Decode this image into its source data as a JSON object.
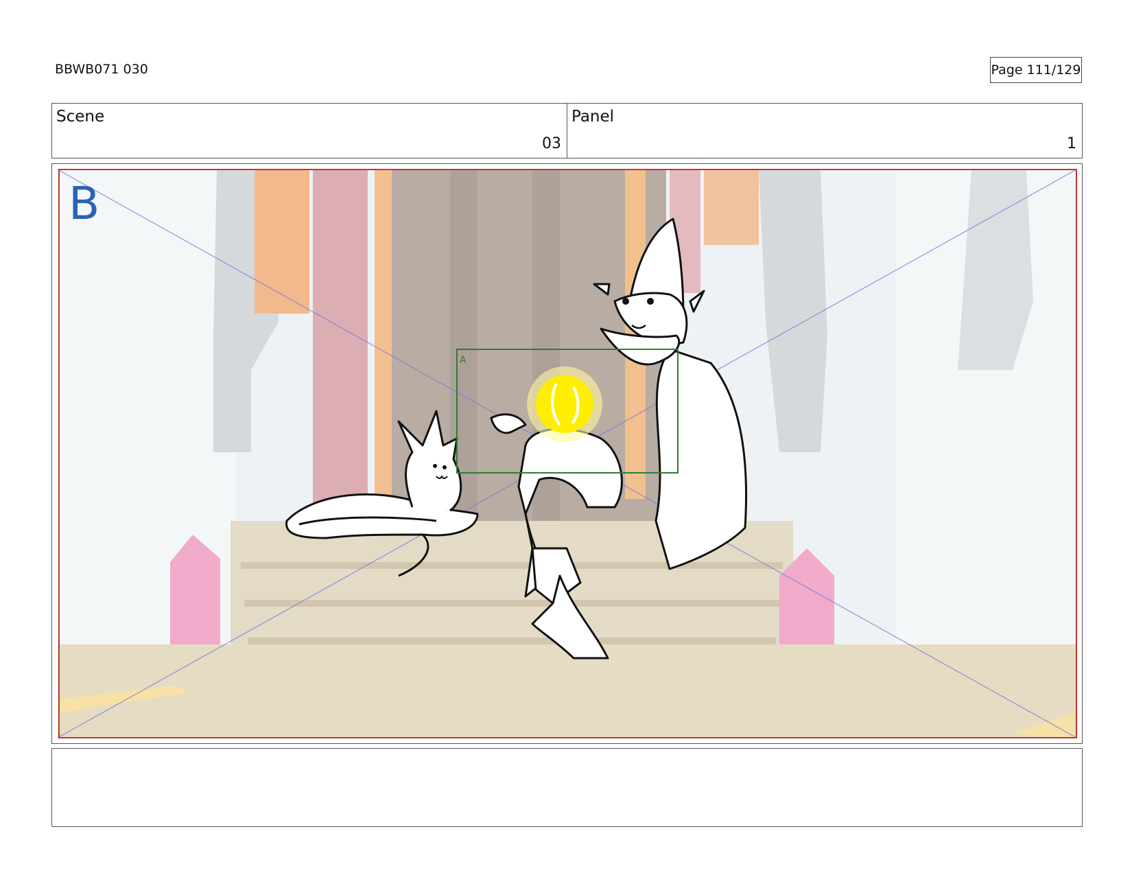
{
  "header": {
    "doc_id": "BBWB071 030",
    "page": "Page 111/129"
  },
  "info": {
    "scene_label": "Scene",
    "scene_value": "03",
    "panel_label": "Panel",
    "panel_value": "1"
  },
  "frame": {
    "layer_letter": "B",
    "camera_letter": "A"
  },
  "colors": {
    "frame_red": "#c0392b",
    "guide_blue": "#7b7bd6",
    "camera_green": "#2e7d32",
    "layer_blue": "#2a62b8",
    "orb_yellow": "#ffee00"
  },
  "notes": ""
}
